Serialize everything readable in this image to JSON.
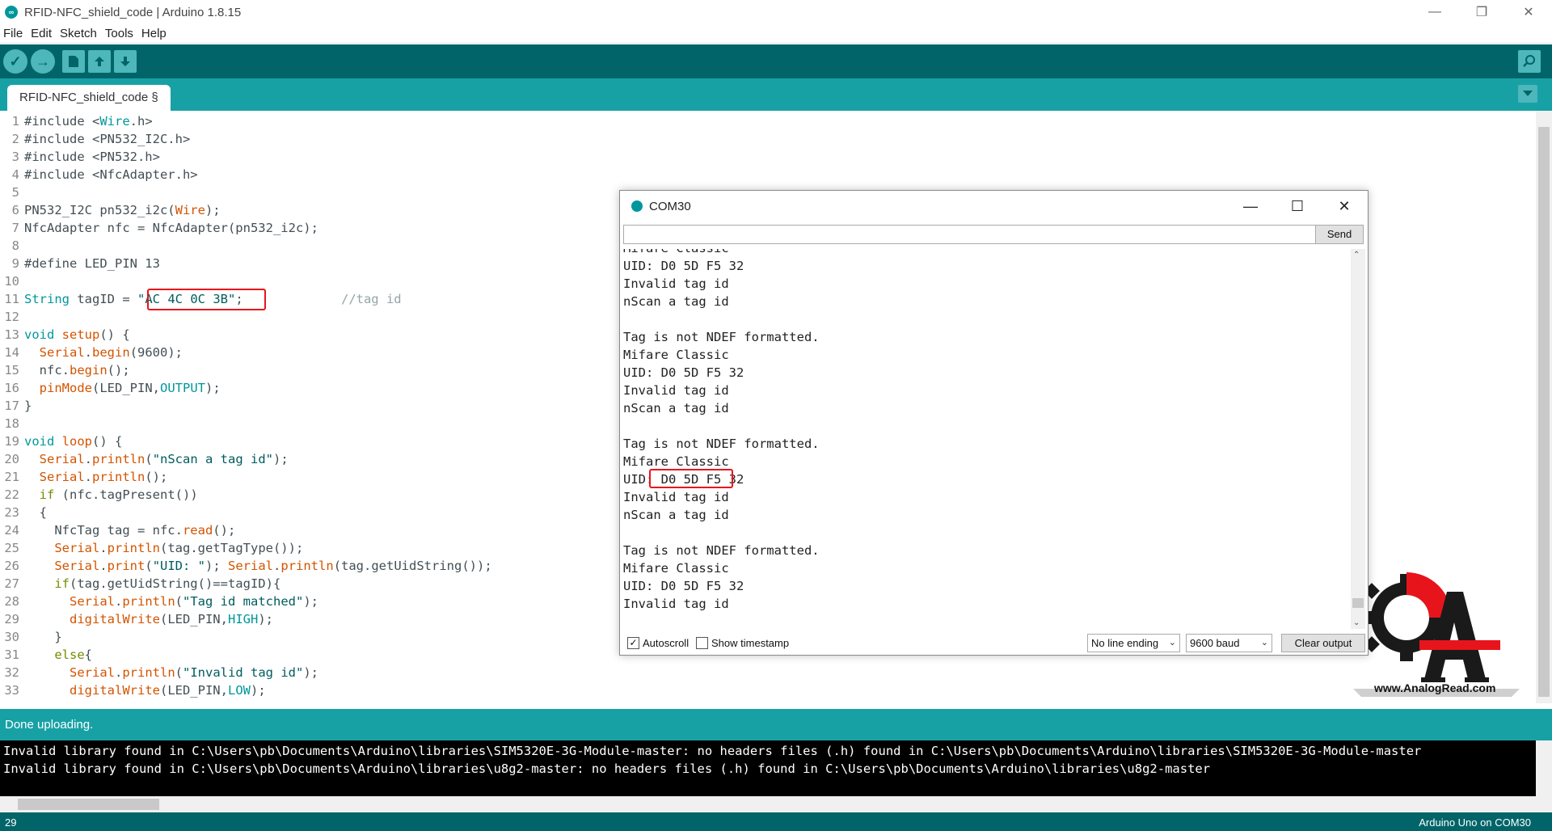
{
  "window": {
    "title": "RFID-NFC_shield_code | Arduino 1.8.15",
    "minimize": "—",
    "maximize": "❐",
    "close": "✕"
  },
  "menu": [
    "File",
    "Edit",
    "Sketch",
    "Tools",
    "Help"
  ],
  "toolbar": {
    "verify_icon": "✓",
    "upload_icon": "→",
    "new_icon": "new-file-icon",
    "open_icon": "open-icon",
    "save_icon": "save-icon",
    "serial_icon": "serial-monitor-icon"
  },
  "tab": {
    "label": "RFID-NFC_shield_code §"
  },
  "code_lines": [
    {
      "n": "1",
      "html": "#include &lt;<span class='const'>Wire</span>.h&gt;"
    },
    {
      "n": "2",
      "html": "#include &lt;PN532_I2C.h&gt;"
    },
    {
      "n": "3",
      "html": "#include &lt;PN532.h&gt;"
    },
    {
      "n": "4",
      "html": "#include &lt;NfcAdapter.h&gt;"
    },
    {
      "n": "5",
      "html": ""
    },
    {
      "n": "6",
      "html": "PN532_I2C pn532_i2c(<span class='fn'>Wire</span>);"
    },
    {
      "n": "7",
      "html": "NfcAdapter nfc = NfcAdapter(pn532_i2c);"
    },
    {
      "n": "8",
      "html": ""
    },
    {
      "n": "9",
      "html": "#define LED_PIN 13"
    },
    {
      "n": "10",
      "html": ""
    },
    {
      "n": "11",
      "html": "<span class='const'>String</span> tagID = <span class='str'>\"AC 4C 0C 3B\"</span>;             <span class='cm'>//tag id</span>"
    },
    {
      "n": "12",
      "html": ""
    },
    {
      "n": "13",
      "html": "<span class='const'>void</span> <span class='fn'>setup</span>() {"
    },
    {
      "n": "14",
      "html": "  <span class='fn'>Serial</span>.<span class='fn'>begin</span>(9600);"
    },
    {
      "n": "15",
      "html": "  nfc.<span class='fn'>begin</span>();"
    },
    {
      "n": "16",
      "html": "  <span class='fn'>pinMode</span>(LED_PIN,<span class='const'>OUTPUT</span>);"
    },
    {
      "n": "17",
      "html": "}"
    },
    {
      "n": "18",
      "html": ""
    },
    {
      "n": "19",
      "html": "<span class='const'>void</span> <span class='fn'>loop</span>() {"
    },
    {
      "n": "20",
      "html": "  <span class='fn'>Serial</span>.<span class='fn'>println</span>(<span class='str'>\"nScan a tag id\"</span>);"
    },
    {
      "n": "21",
      "html": "  <span class='fn'>Serial</span>.<span class='fn'>println</span>();"
    },
    {
      "n": "22",
      "html": "  <span class='kw'>if</span> (nfc.tagPresent())"
    },
    {
      "n": "23",
      "html": "  {"
    },
    {
      "n": "24",
      "html": "    NfcTag tag = nfc.<span class='fn'>read</span>();"
    },
    {
      "n": "25",
      "html": "    <span class='fn'>Serial</span>.<span class='fn'>println</span>(tag.getTagType());"
    },
    {
      "n": "26",
      "html": "    <span class='fn'>Serial</span>.<span class='fn'>print</span>(<span class='str'>\"UID: \"</span>); <span class='fn'>Serial</span>.<span class='fn'>println</span>(tag.getUidString());"
    },
    {
      "n": "27",
      "html": "    <span class='kw'>if</span>(tag.getUidString()==tagID){"
    },
    {
      "n": "28",
      "html": "      <span class='fn'>Serial</span>.<span class='fn'>println</span>(<span class='str'>\"Tag id matched\"</span>);"
    },
    {
      "n": "29",
      "html": "      <span class='fn'>digitalWrite</span>(LED_PIN,<span class='const'>HIGH</span>);"
    },
    {
      "n": "30",
      "html": "    }"
    },
    {
      "n": "31",
      "html": "    <span class='kw'>else</span>{"
    },
    {
      "n": "32",
      "html": "      <span class='fn'>Serial</span>.<span class='fn'>println</span>(<span class='str'>\"Invalid tag id\"</span>);"
    },
    {
      "n": "33",
      "html": "      <span class='fn'>digitalWrite</span>(LED_PIN,<span class='const'>LOW</span>);"
    }
  ],
  "status": {
    "message": "Done uploading."
  },
  "console_lines": [
    "Invalid library found in C:\\Users\\pb\\Documents\\Arduino\\libraries\\SIM5320E-3G-Module-master: no headers files (.h) found in C:\\Users\\pb\\Documents\\Arduino\\libraries\\SIM5320E-3G-Module-master",
    "Invalid library found in C:\\Users\\pb\\Documents\\Arduino\\libraries\\u8g2-master: no headers files (.h) found in C:\\Users\\pb\\Documents\\Arduino\\libraries\\u8g2-master"
  ],
  "bottom": {
    "line": "29",
    "board": "Arduino Uno on COM30"
  },
  "serial_monitor": {
    "title": "COM30",
    "input_value": "",
    "send_label": "Send",
    "output_lines": [
      "Mifare Classic",
      "UID: D0 5D F5 32",
      "Invalid tag id",
      "nScan a tag id",
      "",
      "Tag is not NDEF formatted.",
      "Mifare Classic",
      "UID: D0 5D F5 32",
      "Invalid tag id",
      "nScan a tag id",
      "",
      "Tag is not NDEF formatted.",
      "Mifare Classic",
      "UID: D0 5D F5 32",
      "Invalid tag id",
      "nScan a tag id",
      "",
      "Tag is not NDEF formatted.",
      "Mifare Classic",
      "UID: D0 5D F5 32",
      "Invalid tag id"
    ],
    "autoscroll_label": "Autoscroll",
    "autoscroll_checked": true,
    "timestamp_label": "Show timestamp",
    "timestamp_checked": false,
    "line_ending": "No line ending",
    "baud": "9600 baud",
    "clear_label": "Clear output"
  },
  "watermark": {
    "url": "www.AnalogRead.com"
  },
  "colors": {
    "teal_dark": "#006468",
    "teal": "#17a1a5",
    "highlight_red": "#e8141b"
  }
}
